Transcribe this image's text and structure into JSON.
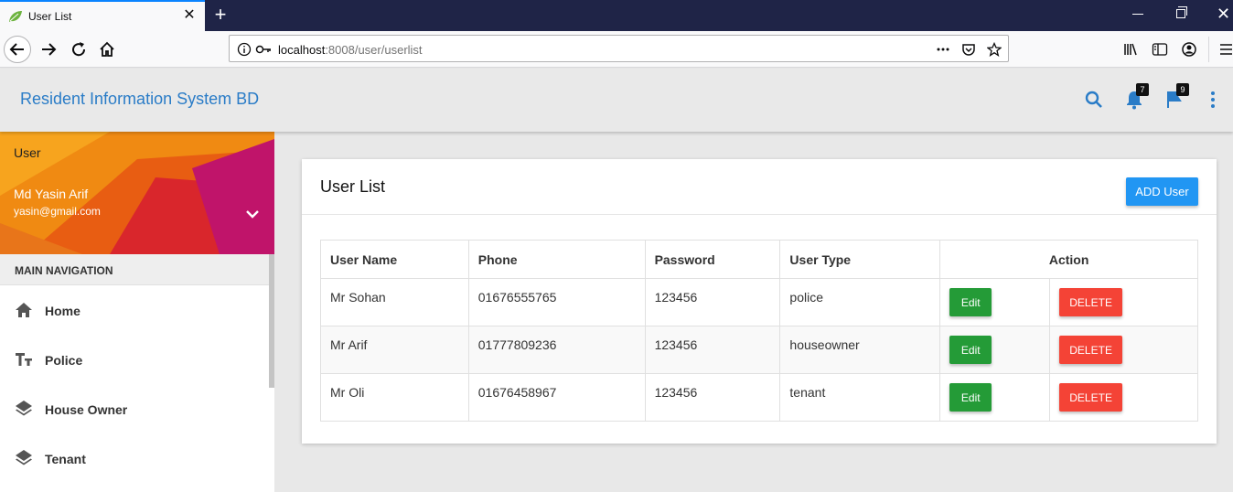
{
  "browser": {
    "tab_title": "User List",
    "tab_close": "✕",
    "new_tab": "+",
    "window_close": "✕",
    "url_host": "localhost",
    "url_path": ":8008/user/userlist"
  },
  "header": {
    "app_title": "Resident Information System BD",
    "notifications_count": "7",
    "flags_count": "9"
  },
  "sidebar": {
    "user_role": "User",
    "user_name": "Md Yasin Arif",
    "user_email": "yasin@gmail.com",
    "nav_header": "MAIN NAVIGATION",
    "items": [
      {
        "label": "Home",
        "icon": "home-icon"
      },
      {
        "label": "Police",
        "icon": "text-fields-icon"
      },
      {
        "label": "House Owner",
        "icon": "layers-icon"
      },
      {
        "label": "Tenant",
        "icon": "layers-icon"
      }
    ]
  },
  "main": {
    "card_title": "User List",
    "add_button": "ADD User",
    "columns": [
      "User Name",
      "Phone",
      "Password",
      "User Type",
      "Action"
    ],
    "rows": [
      {
        "name": "Mr Sohan",
        "phone": "01676555765",
        "password": "123456",
        "type": "police"
      },
      {
        "name": "Mr Arif",
        "phone": "01777809236",
        "password": "123456",
        "type": "houseowner"
      },
      {
        "name": "Mr Oli",
        "phone": "01676458967",
        "password": "123456",
        "type": "tenant"
      }
    ],
    "edit_label": "Edit",
    "delete_label": "DELETE"
  },
  "colors": {
    "accent": "#2196f3",
    "title_blue": "#2a7cc7",
    "edit_green": "#249b37",
    "delete_red": "#f44336"
  }
}
